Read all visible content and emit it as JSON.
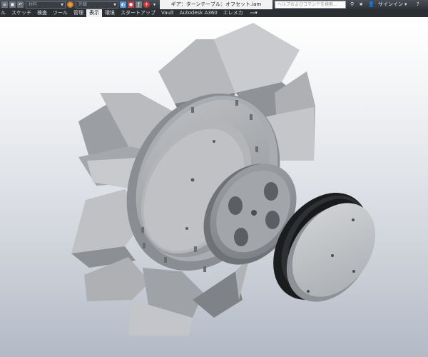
{
  "quick_access": {
    "material_placeholder": "材料",
    "appearance_placeholder": "外観"
  },
  "document": {
    "title": "ギア：ターンテーブル：オフセット.iam"
  },
  "search": {
    "placeholder": "ヘルプおよびコマンドを検索..."
  },
  "account": {
    "sign_in_label": "サインイン"
  },
  "ribbon": {
    "tabs": [
      {
        "label": "ル"
      },
      {
        "label": "スケッチ"
      },
      {
        "label": "検査"
      },
      {
        "label": "ツール"
      },
      {
        "label": "管理"
      },
      {
        "label": "表示",
        "active": true
      },
      {
        "label": "環境"
      },
      {
        "label": "スタートアップ"
      },
      {
        "label": "Vault"
      },
      {
        "label": "Autodesk A360"
      },
      {
        "label": "エレメカ"
      }
    ]
  },
  "colors": {
    "part_gray": "#a7a9ad",
    "part_light": "#cfd1d4",
    "part_dark": "#6e7175",
    "belt_black": "#1b1c1e"
  },
  "icons": [
    "save-icon",
    "undo-icon",
    "redo-icon",
    "color-swatch-icon",
    "measure-icon",
    "help-icon",
    "star-icon",
    "user-icon",
    "chevron-down-icon"
  ]
}
